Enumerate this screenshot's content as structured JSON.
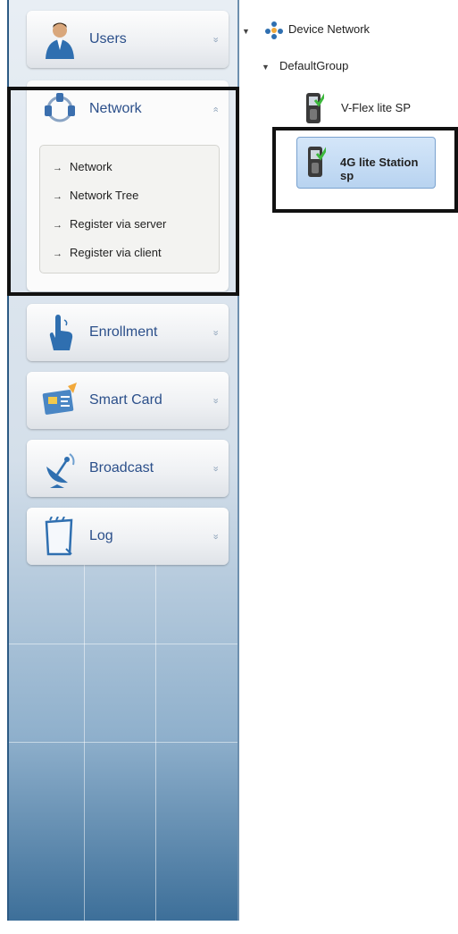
{
  "sidebar": {
    "users": {
      "label": "Users",
      "chevron": "»",
      "icon": "user-icon"
    },
    "network": {
      "label": "Network",
      "chevron": "«",
      "icon": "network-icon",
      "items": [
        {
          "arrow": "→",
          "label": "Network"
        },
        {
          "arrow": "→",
          "label": "Network Tree"
        },
        {
          "arrow": "→",
          "label": "Register via server"
        },
        {
          "arrow": "→",
          "label": "Register via client"
        }
      ]
    },
    "enrollment": {
      "label": "Enrollment",
      "chevron": "»",
      "icon": "hand-pointer-icon"
    },
    "smart_card": {
      "label": "Smart Card",
      "chevron": "»",
      "icon": "smart-card-icon"
    },
    "broadcast": {
      "label": "Broadcast",
      "chevron": "»",
      "icon": "satellite-dish-icon"
    },
    "log": {
      "label": "Log",
      "chevron": "»",
      "icon": "notepad-icon"
    }
  },
  "tree": {
    "root": {
      "toggle": "▼",
      "label": "Device Network",
      "icon": "device-network-icon"
    },
    "group": {
      "toggle": "▼",
      "label": "DefaultGroup"
    },
    "devices": [
      {
        "label": "V-Flex lite SP",
        "status": "connected",
        "icon": "fingerprint-device-icon"
      },
      {
        "label": "4G lite Station sp",
        "status": "connected",
        "selected": true,
        "icon": "fingerprint-device-icon"
      }
    ]
  },
  "colors": {
    "accent": "#2b4f8a",
    "selection": "#b8d3f0",
    "check": "#3cb83c",
    "highlight_border": "#111111"
  }
}
